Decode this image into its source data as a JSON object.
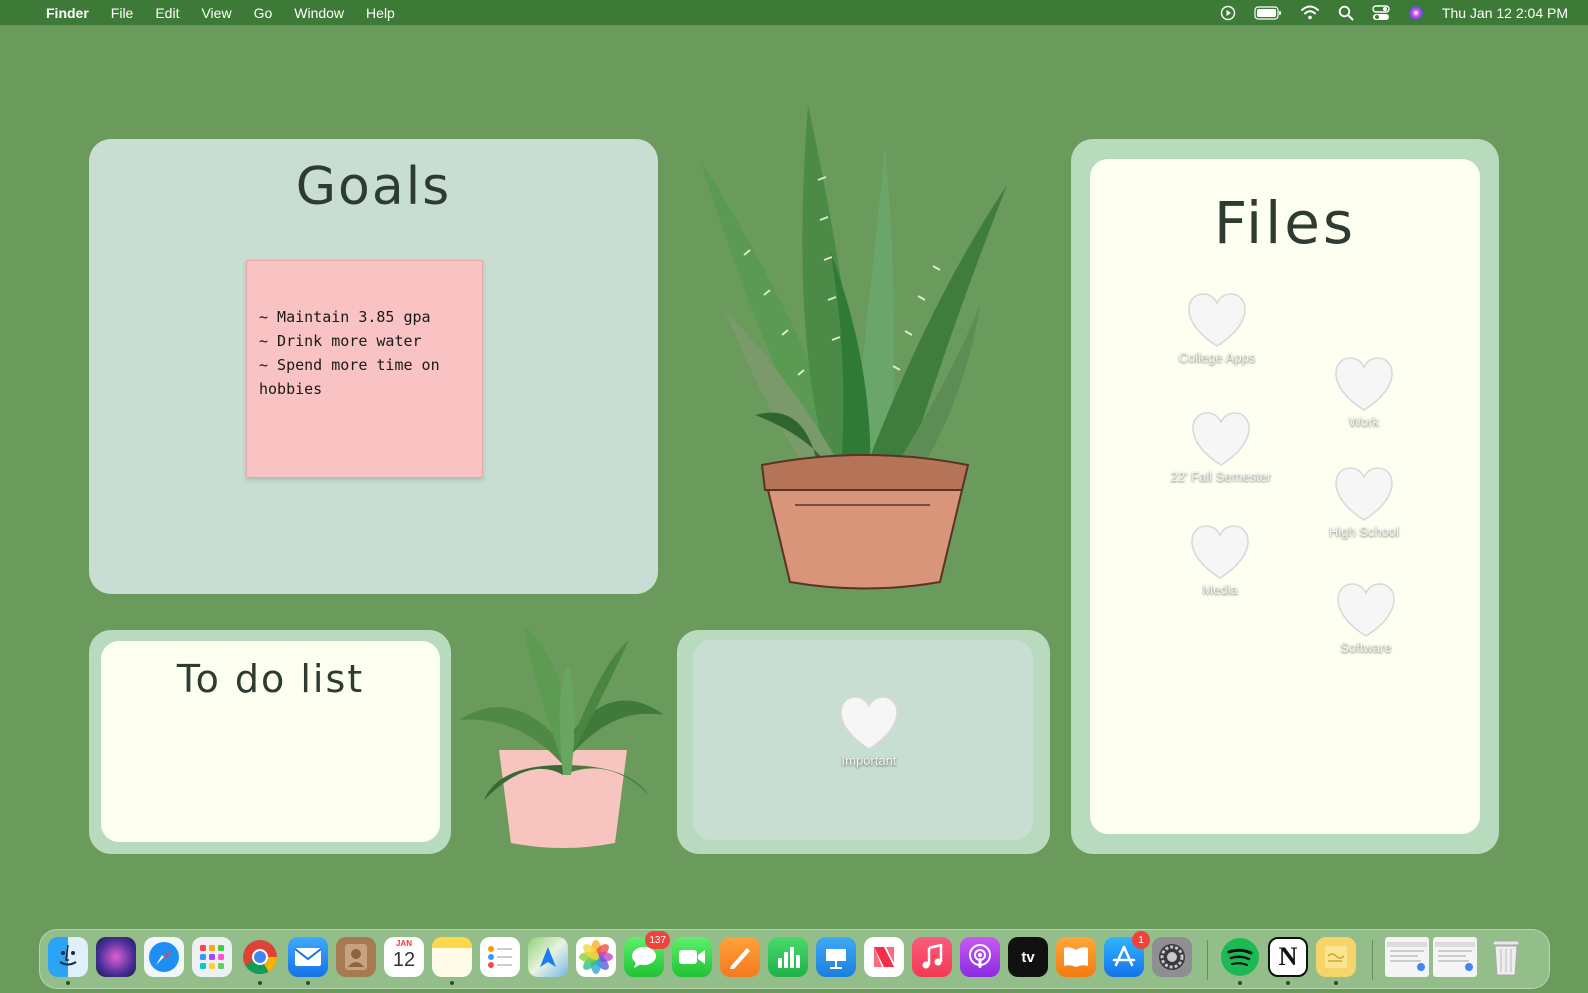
{
  "menubar": {
    "app_name": "Finder",
    "menus": [
      "File",
      "Edit",
      "View",
      "Go",
      "Window",
      "Help"
    ],
    "clock": "Thu Jan 12  2:04 PM",
    "status_icons": [
      "play-circle-icon",
      "battery-icon",
      "wifi-icon",
      "spotlight-search-icon",
      "control-center-icon",
      "siri-icon"
    ]
  },
  "goals": {
    "title": "Goals",
    "sticky_lines": [
      "~ Maintain 3.85 gpa",
      "~ Drink more water",
      "~ Spend more time on hobbies"
    ]
  },
  "todo": {
    "title": "To do list"
  },
  "important": {
    "label": "Important"
  },
  "files": {
    "title": "Files",
    "folders": [
      "College Apps",
      "Work",
      "22' Fall Semester",
      "High School",
      "Media",
      "Software"
    ]
  },
  "dock": {
    "apps": [
      "Finder",
      "Siri",
      "Safari",
      "Launchpad",
      "Google Chrome",
      "Mail",
      "Contacts",
      "Calendar",
      "Notes",
      "Reminders",
      "Maps",
      "Photos",
      "Messages",
      "FaceTime",
      "Pages",
      "Numbers",
      "Keynote",
      "News",
      "Music",
      "Podcasts",
      "Apple TV",
      "Books",
      "App Store",
      "System Settings",
      "Spotify",
      "Notion",
      "Stickies",
      "Chrome Window 1",
      "Chrome Window 2",
      "Trash"
    ],
    "calendar_month": "JAN",
    "calendar_day": "12",
    "messages_badge": "137",
    "appstore_badge": "1",
    "tv_label": "tv",
    "notion_label": "N"
  },
  "colors": {
    "desktop": "#6a9a5c",
    "menubar": "#3d7a37",
    "panel_sage": "#c8ded2",
    "panel_mint": "#b8dbbe",
    "panel_cream": "#fdfff1",
    "sticky_pink": "#f9c3c4"
  }
}
